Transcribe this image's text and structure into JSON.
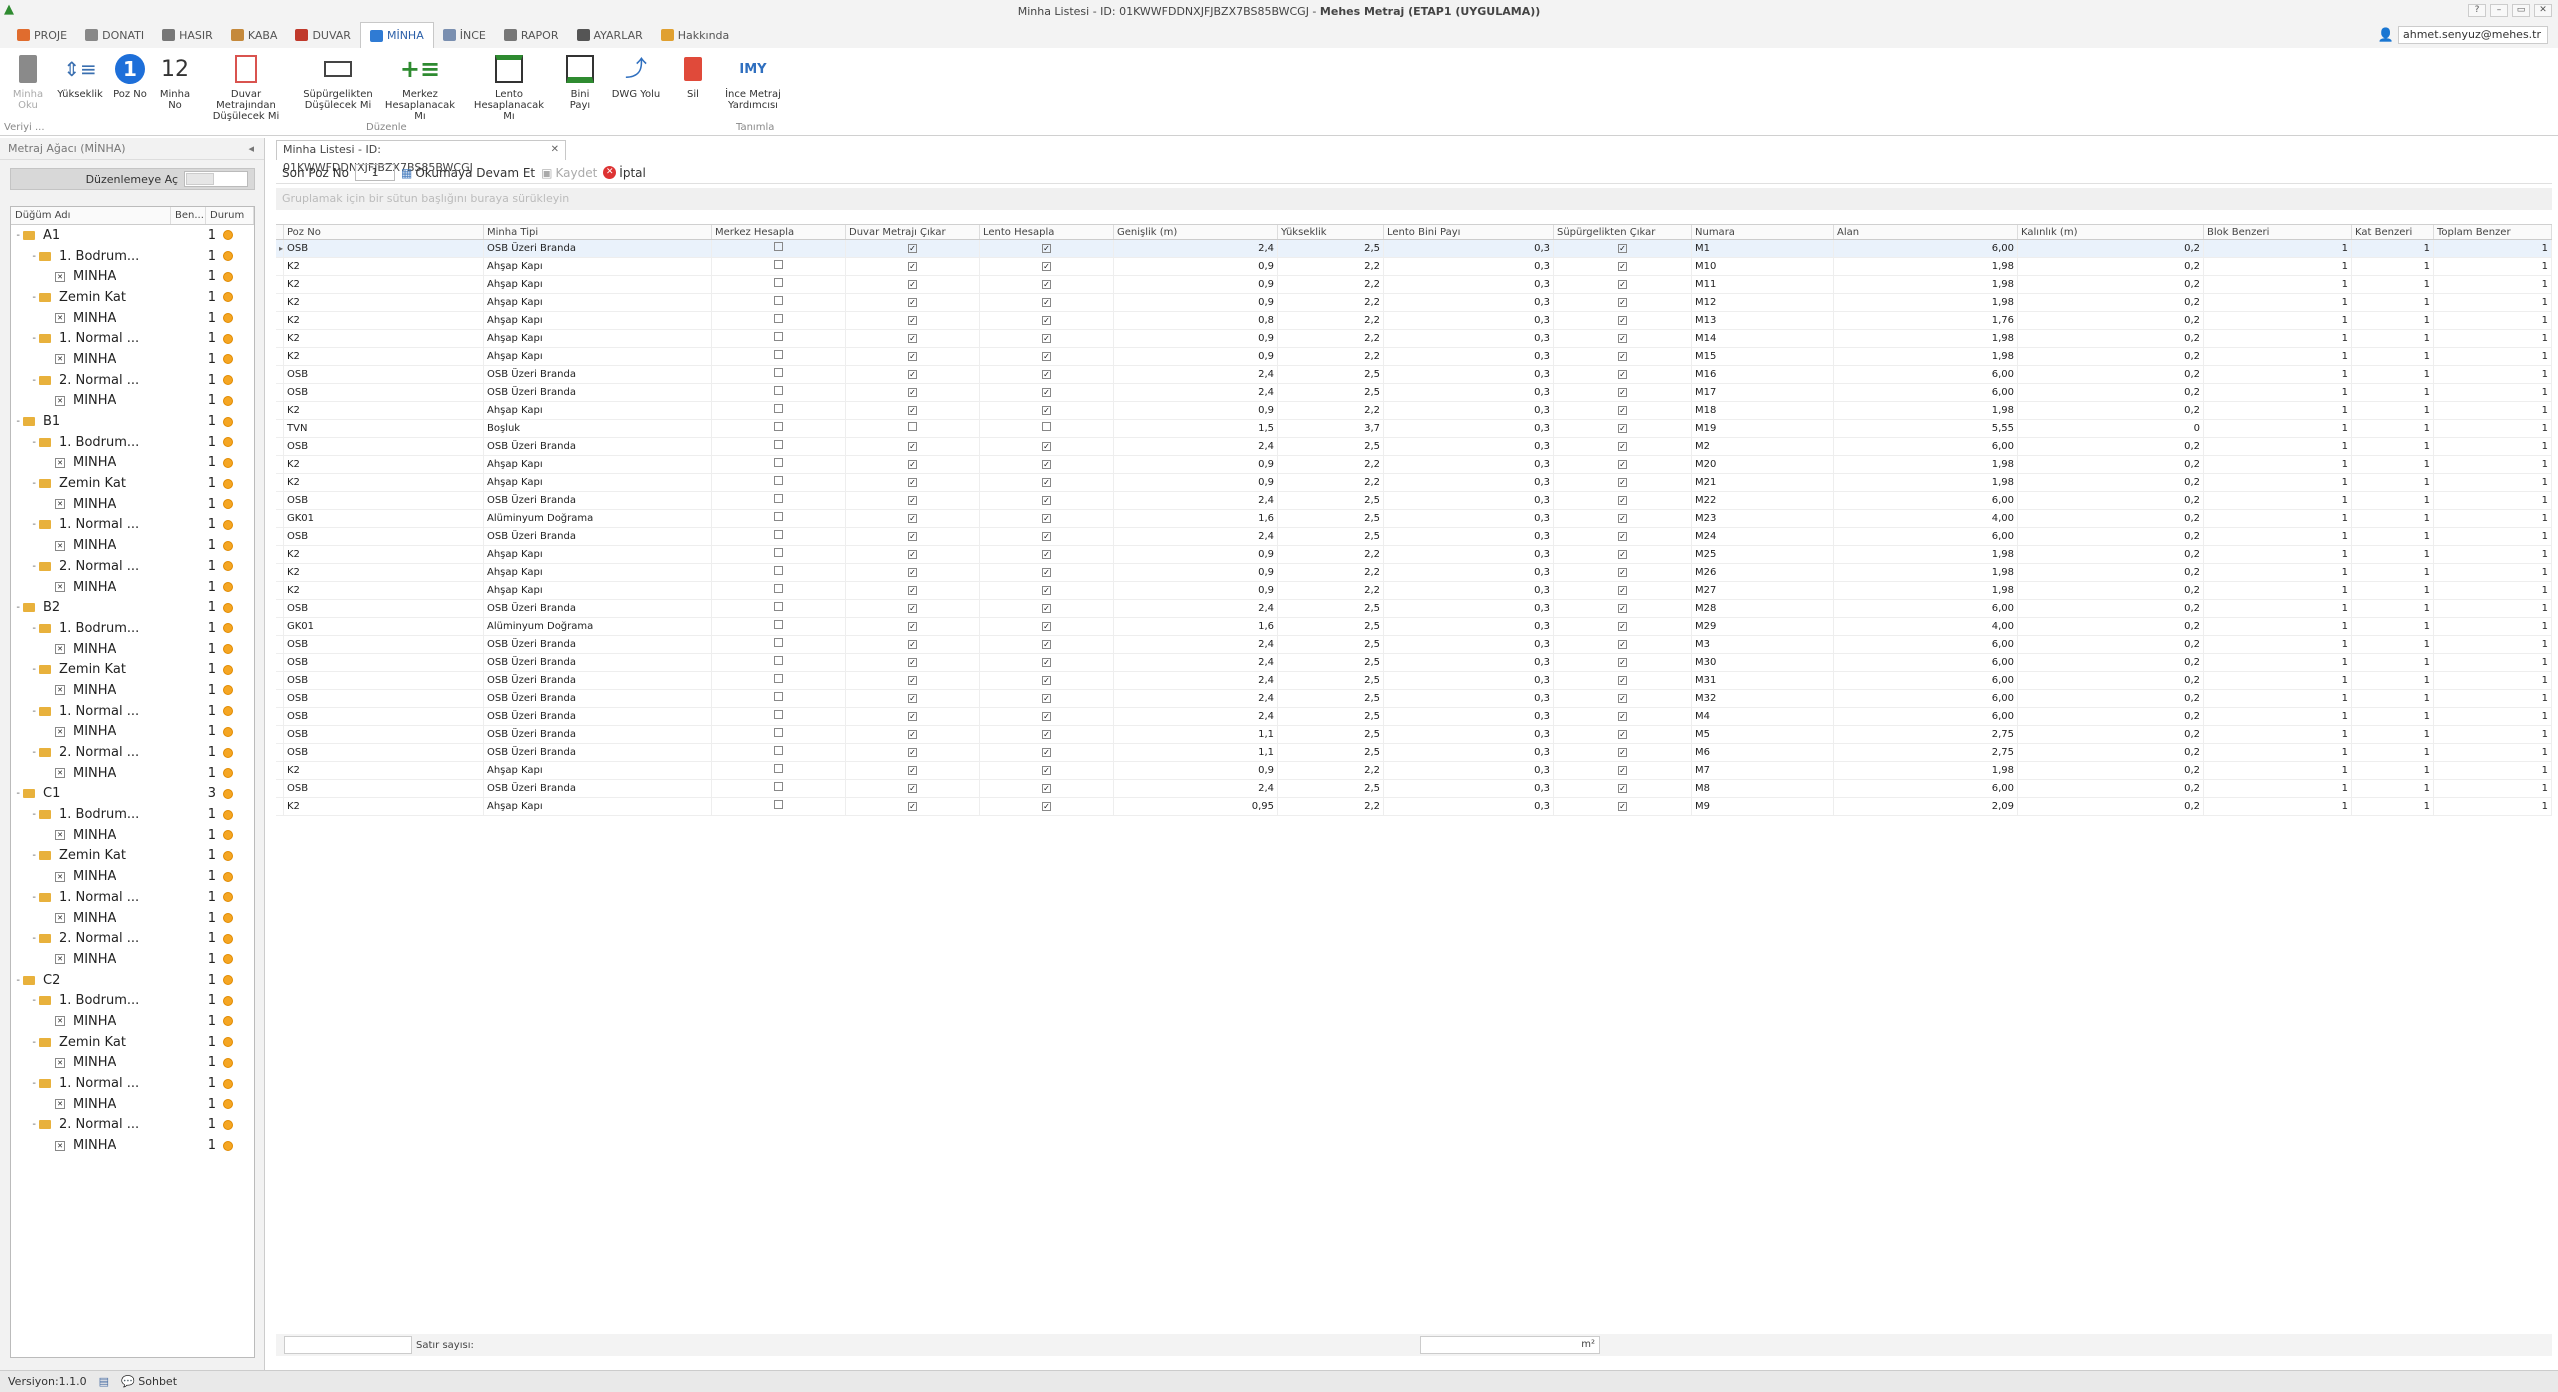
{
  "window": {
    "title": "Minha Listesi - ID: 01KWWFDDNXJFJBZX7BS85BWCGJ - ",
    "title_bold": "Mehes Metraj (ETAP1 (UYGULAMA))"
  },
  "menu": {
    "tabs": [
      {
        "label": "PROJE",
        "color": "#e06c2e"
      },
      {
        "label": "DONATI",
        "color": "#888"
      },
      {
        "label": "HASIR",
        "color": "#777"
      },
      {
        "label": "KABA",
        "color": "#c5893b"
      },
      {
        "label": "DUVAR",
        "color": "#c0392b"
      },
      {
        "label": "MİNHA",
        "color": "#2f7bd4"
      },
      {
        "label": "İNCE",
        "color": "#7a8fb0"
      },
      {
        "label": "RAPOR",
        "color": "#777"
      },
      {
        "label": "AYARLAR",
        "color": "#555"
      },
      {
        "label": "Hakkında",
        "color": "#e0a030"
      }
    ]
  },
  "user": {
    "email": "ahmet.senyuz@mehes.tr"
  },
  "ribbon": {
    "buttons": [
      {
        "label": "Minha\nOku",
        "dis": true
      },
      {
        "label": "Yükseklik"
      },
      {
        "label": "Poz No"
      },
      {
        "label": "Minha\nNo"
      },
      {
        "label": "Duvar Metrajından\nDüşülecek Mi"
      },
      {
        "label": "Süpürgelikten\nDüşülecek Mi"
      },
      {
        "label": "Merkez\nHesaplanacak Mı"
      },
      {
        "label": "Lento\nHesaplanacak Mı"
      },
      {
        "label": "Bini Payı"
      },
      {
        "label": "DWG Yolu"
      },
      {
        "label": "Sil"
      },
      {
        "label": "İnce Metraj\nYardımcısı"
      }
    ],
    "groups": [
      "Veriyi ...",
      "Düzenle",
      "Tanımla"
    ],
    "poz_badge": "1",
    "minha_badge": "12",
    "imy_badge": "IMY"
  },
  "left": {
    "title": "Metraj Ağacı (MİNHA)",
    "edit_label": "Düzenlemeye Aç",
    "cols": [
      "Düğüm Adı",
      "Ben...",
      "Durum"
    ],
    "tree": [
      {
        "lvl": 0,
        "type": "f",
        "name": "A1",
        "ben": "1"
      },
      {
        "lvl": 1,
        "type": "f",
        "name": "1. Bodrum...",
        "ben": "1"
      },
      {
        "lvl": 2,
        "type": "m",
        "name": "MİNHA",
        "ben": "1"
      },
      {
        "lvl": 1,
        "type": "f",
        "name": "Zemin Kat",
        "ben": "1"
      },
      {
        "lvl": 2,
        "type": "m",
        "name": "MİNHA",
        "ben": "1"
      },
      {
        "lvl": 1,
        "type": "f",
        "name": "1. Normal ...",
        "ben": "1"
      },
      {
        "lvl": 2,
        "type": "m",
        "name": "MİNHA",
        "ben": "1"
      },
      {
        "lvl": 1,
        "type": "f",
        "name": "2. Normal ...",
        "ben": "1"
      },
      {
        "lvl": 2,
        "type": "m",
        "name": "MİNHA",
        "ben": "1"
      },
      {
        "lvl": 0,
        "type": "f",
        "name": "B1",
        "ben": "1"
      },
      {
        "lvl": 1,
        "type": "f",
        "name": "1. Bodrum...",
        "ben": "1"
      },
      {
        "lvl": 2,
        "type": "m",
        "name": "MİNHA",
        "ben": "1"
      },
      {
        "lvl": 1,
        "type": "f",
        "name": "Zemin Kat",
        "ben": "1"
      },
      {
        "lvl": 2,
        "type": "m",
        "name": "MİNHA",
        "ben": "1"
      },
      {
        "lvl": 1,
        "type": "f",
        "name": "1. Normal ...",
        "ben": "1"
      },
      {
        "lvl": 2,
        "type": "m",
        "name": "MİNHA",
        "ben": "1"
      },
      {
        "lvl": 1,
        "type": "f",
        "name": "2. Normal ...",
        "ben": "1"
      },
      {
        "lvl": 2,
        "type": "m",
        "name": "MİNHA",
        "ben": "1"
      },
      {
        "lvl": 0,
        "type": "f",
        "name": "B2",
        "ben": "1"
      },
      {
        "lvl": 1,
        "type": "f",
        "name": "1. Bodrum...",
        "ben": "1"
      },
      {
        "lvl": 2,
        "type": "m",
        "name": "MİNHA",
        "ben": "1"
      },
      {
        "lvl": 1,
        "type": "f",
        "name": "Zemin Kat",
        "ben": "1"
      },
      {
        "lvl": 2,
        "type": "m",
        "name": "MİNHA",
        "ben": "1"
      },
      {
        "lvl": 1,
        "type": "f",
        "name": "1. Normal ...",
        "ben": "1"
      },
      {
        "lvl": 2,
        "type": "m",
        "name": "MİNHA",
        "ben": "1"
      },
      {
        "lvl": 1,
        "type": "f",
        "name": "2. Normal ...",
        "ben": "1"
      },
      {
        "lvl": 2,
        "type": "m",
        "name": "MİNHA",
        "ben": "1"
      },
      {
        "lvl": 0,
        "type": "f",
        "name": "C1",
        "ben": "3"
      },
      {
        "lvl": 1,
        "type": "f",
        "name": "1. Bodrum...",
        "ben": "1"
      },
      {
        "lvl": 2,
        "type": "m",
        "name": "MİNHA",
        "ben": "1"
      },
      {
        "lvl": 1,
        "type": "f",
        "name": "Zemin Kat",
        "ben": "1"
      },
      {
        "lvl": 2,
        "type": "m",
        "name": "MİNHA",
        "ben": "1"
      },
      {
        "lvl": 1,
        "type": "f",
        "name": "1. Normal ...",
        "ben": "1"
      },
      {
        "lvl": 2,
        "type": "m",
        "name": "MİNHA",
        "ben": "1"
      },
      {
        "lvl": 1,
        "type": "f",
        "name": "2. Normal ...",
        "ben": "1"
      },
      {
        "lvl": 2,
        "type": "m",
        "name": "MİNHA",
        "ben": "1"
      },
      {
        "lvl": 0,
        "type": "f",
        "name": "C2",
        "ben": "1"
      },
      {
        "lvl": 1,
        "type": "f",
        "name": "1. Bodrum...",
        "ben": "1"
      },
      {
        "lvl": 2,
        "type": "m",
        "name": "MİNHA",
        "ben": "1"
      },
      {
        "lvl": 1,
        "type": "f",
        "name": "Zemin Kat",
        "ben": "1"
      },
      {
        "lvl": 2,
        "type": "m",
        "name": "MİNHA",
        "ben": "1"
      },
      {
        "lvl": 1,
        "type": "f",
        "name": "1. Normal ...",
        "ben": "1"
      },
      {
        "lvl": 2,
        "type": "m",
        "name": "MİNHA",
        "ben": "1"
      },
      {
        "lvl": 1,
        "type": "f",
        "name": "2. Normal ...",
        "ben": "1"
      },
      {
        "lvl": 2,
        "type": "m",
        "name": "MİNHA",
        "ben": "1"
      }
    ]
  },
  "doc": {
    "tab": "Minha Listesi - ID: 01KWWFDDNXJFJBZX7BS85BWCGJ",
    "son_poz_label": "Son Poz No",
    "son_poz_value": "1",
    "read_btn": "Okumaya Devam Et",
    "save_btn": "Kaydet",
    "cancel_btn": "İptal",
    "group_hint": "Gruplamak için bir sütun başlığını buraya sürükleyin"
  },
  "grid": {
    "columns": [
      "Poz No",
      "Minha Tipi",
      "Merkez Hesapla",
      "Duvar Metrajı Çıkar",
      "Lento Hesapla",
      "Genişlik (m)",
      "Yükseklik",
      "Lento Bini Payı",
      "Süpürgelikten Çıkar",
      "Numara",
      "Alan",
      "Kalınlık (m)",
      "Blok Benzeri",
      "Kat Benzeri",
      "Toplam Benzer"
    ],
    "rows": [
      [
        "OSB",
        "OSB Üzeri Branda",
        0,
        1,
        1,
        "2,4",
        "2,5",
        "0,3",
        1,
        "M1",
        "6,00",
        "0,2",
        "1",
        "1",
        "1"
      ],
      [
        "K2",
        "Ahşap Kapı",
        0,
        1,
        1,
        "0,9",
        "2,2",
        "0,3",
        1,
        "M10",
        "1,98",
        "0,2",
        "1",
        "1",
        "1"
      ],
      [
        "K2",
        "Ahşap Kapı",
        0,
        1,
        1,
        "0,9",
        "2,2",
        "0,3",
        1,
        "M11",
        "1,98",
        "0,2",
        "1",
        "1",
        "1"
      ],
      [
        "K2",
        "Ahşap Kapı",
        0,
        1,
        1,
        "0,9",
        "2,2",
        "0,3",
        1,
        "M12",
        "1,98",
        "0,2",
        "1",
        "1",
        "1"
      ],
      [
        "K2",
        "Ahşap Kapı",
        0,
        1,
        1,
        "0,8",
        "2,2",
        "0,3",
        1,
        "M13",
        "1,76",
        "0,2",
        "1",
        "1",
        "1"
      ],
      [
        "K2",
        "Ahşap Kapı",
        0,
        1,
        1,
        "0,9",
        "2,2",
        "0,3",
        1,
        "M14",
        "1,98",
        "0,2",
        "1",
        "1",
        "1"
      ],
      [
        "K2",
        "Ahşap Kapı",
        0,
        1,
        1,
        "0,9",
        "2,2",
        "0,3",
        1,
        "M15",
        "1,98",
        "0,2",
        "1",
        "1",
        "1"
      ],
      [
        "OSB",
        "OSB Üzeri Branda",
        0,
        1,
        1,
        "2,4",
        "2,5",
        "0,3",
        1,
        "M16",
        "6,00",
        "0,2",
        "1",
        "1",
        "1"
      ],
      [
        "OSB",
        "OSB Üzeri Branda",
        0,
        1,
        1,
        "2,4",
        "2,5",
        "0,3",
        1,
        "M17",
        "6,00",
        "0,2",
        "1",
        "1",
        "1"
      ],
      [
        "K2",
        "Ahşap Kapı",
        0,
        1,
        1,
        "0,9",
        "2,2",
        "0,3",
        1,
        "M18",
        "1,98",
        "0,2",
        "1",
        "1",
        "1"
      ],
      [
        "TVN",
        "Boşluk",
        0,
        0,
        0,
        "1,5",
        "3,7",
        "0,3",
        1,
        "M19",
        "5,55",
        "0",
        "1",
        "1",
        "1"
      ],
      [
        "OSB",
        "OSB Üzeri Branda",
        0,
        1,
        1,
        "2,4",
        "2,5",
        "0,3",
        1,
        "M2",
        "6,00",
        "0,2",
        "1",
        "1",
        "1"
      ],
      [
        "K2",
        "Ahşap Kapı",
        0,
        1,
        1,
        "0,9",
        "2,2",
        "0,3",
        1,
        "M20",
        "1,98",
        "0,2",
        "1",
        "1",
        "1"
      ],
      [
        "K2",
        "Ahşap Kapı",
        0,
        1,
        1,
        "0,9",
        "2,2",
        "0,3",
        1,
        "M21",
        "1,98",
        "0,2",
        "1",
        "1",
        "1"
      ],
      [
        "OSB",
        "OSB Üzeri Branda",
        0,
        1,
        1,
        "2,4",
        "2,5",
        "0,3",
        1,
        "M22",
        "6,00",
        "0,2",
        "1",
        "1",
        "1"
      ],
      [
        "GK01",
        "Alüminyum Doğrama",
        0,
        1,
        1,
        "1,6",
        "2,5",
        "0,3",
        1,
        "M23",
        "4,00",
        "0,2",
        "1",
        "1",
        "1"
      ],
      [
        "OSB",
        "OSB Üzeri Branda",
        0,
        1,
        1,
        "2,4",
        "2,5",
        "0,3",
        1,
        "M24",
        "6,00",
        "0,2",
        "1",
        "1",
        "1"
      ],
      [
        "K2",
        "Ahşap Kapı",
        0,
        1,
        1,
        "0,9",
        "2,2",
        "0,3",
        1,
        "M25",
        "1,98",
        "0,2",
        "1",
        "1",
        "1"
      ],
      [
        "K2",
        "Ahşap Kapı",
        0,
        1,
        1,
        "0,9",
        "2,2",
        "0,3",
        1,
        "M26",
        "1,98",
        "0,2",
        "1",
        "1",
        "1"
      ],
      [
        "K2",
        "Ahşap Kapı",
        0,
        1,
        1,
        "0,9",
        "2,2",
        "0,3",
        1,
        "M27",
        "1,98",
        "0,2",
        "1",
        "1",
        "1"
      ],
      [
        "OSB",
        "OSB Üzeri Branda",
        0,
        1,
        1,
        "2,4",
        "2,5",
        "0,3",
        1,
        "M28",
        "6,00",
        "0,2",
        "1",
        "1",
        "1"
      ],
      [
        "GK01",
        "Alüminyum Doğrama",
        0,
        1,
        1,
        "1,6",
        "2,5",
        "0,3",
        1,
        "M29",
        "4,00",
        "0,2",
        "1",
        "1",
        "1"
      ],
      [
        "OSB",
        "OSB Üzeri Branda",
        0,
        1,
        1,
        "2,4",
        "2,5",
        "0,3",
        1,
        "M3",
        "6,00",
        "0,2",
        "1",
        "1",
        "1"
      ],
      [
        "OSB",
        "OSB Üzeri Branda",
        0,
        1,
        1,
        "2,4",
        "2,5",
        "0,3",
        1,
        "M30",
        "6,00",
        "0,2",
        "1",
        "1",
        "1"
      ],
      [
        "OSB",
        "OSB Üzeri Branda",
        0,
        1,
        1,
        "2,4",
        "2,5",
        "0,3",
        1,
        "M31",
        "6,00",
        "0,2",
        "1",
        "1",
        "1"
      ],
      [
        "OSB",
        "OSB Üzeri Branda",
        0,
        1,
        1,
        "2,4",
        "2,5",
        "0,3",
        1,
        "M32",
        "6,00",
        "0,2",
        "1",
        "1",
        "1"
      ],
      [
        "OSB",
        "OSB Üzeri Branda",
        0,
        1,
        1,
        "2,4",
        "2,5",
        "0,3",
        1,
        "M4",
        "6,00",
        "0,2",
        "1",
        "1",
        "1"
      ],
      [
        "OSB",
        "OSB Üzeri Branda",
        0,
        1,
        1,
        "1,1",
        "2,5",
        "0,3",
        1,
        "M5",
        "2,75",
        "0,2",
        "1",
        "1",
        "1"
      ],
      [
        "OSB",
        "OSB Üzeri Branda",
        0,
        1,
        1,
        "1,1",
        "2,5",
        "0,3",
        1,
        "M6",
        "2,75",
        "0,2",
        "1",
        "1",
        "1"
      ],
      [
        "K2",
        "Ahşap Kapı",
        0,
        1,
        1,
        "0,9",
        "2,2",
        "0,3",
        1,
        "M7",
        "1,98",
        "0,2",
        "1",
        "1",
        "1"
      ],
      [
        "OSB",
        "OSB Üzeri Branda",
        0,
        1,
        1,
        "2,4",
        "2,5",
        "0,3",
        1,
        "M8",
        "6,00",
        "0,2",
        "1",
        "1",
        "1"
      ],
      [
        "K2",
        "Ahşap Kapı",
        0,
        1,
        1,
        "0,95",
        "2,2",
        "0,3",
        1,
        "M9",
        "2,09",
        "0,2",
        "1",
        "1",
        "1"
      ]
    ]
  },
  "footer": {
    "count_label": "Satır sayısı:",
    "area_unit": "m²"
  },
  "status": {
    "version": "Versiyon:1.1.0",
    "chat": "Sohbet"
  }
}
